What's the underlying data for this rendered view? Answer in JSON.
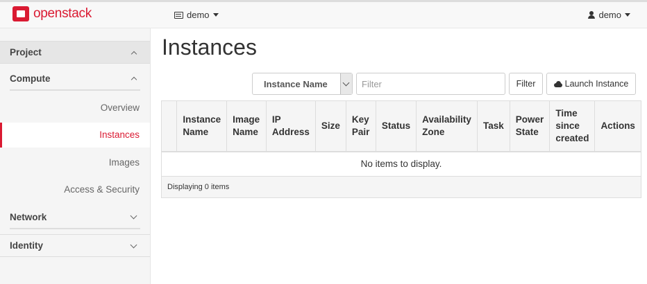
{
  "navbar": {
    "brand": "openstack",
    "project_label": "demo",
    "user_label": "demo"
  },
  "sidebar": {
    "project": "Project",
    "compute": "Compute",
    "items": [
      {
        "label": "Overview"
      },
      {
        "label": "Instances"
      },
      {
        "label": "Images"
      },
      {
        "label": "Access & Security"
      }
    ],
    "network": "Network",
    "identity": "Identity"
  },
  "main": {
    "title": "Instances",
    "filter_field": "Instance Name",
    "filter_placeholder": "Filter",
    "filter_button": "Filter",
    "launch_button": "Launch Instance",
    "columns": [
      [
        "Instance",
        "Name"
      ],
      [
        "Image",
        "Name"
      ],
      [
        "IP",
        "Address"
      ],
      [
        "Size"
      ],
      [
        "Key",
        "Pair"
      ],
      [
        "Status"
      ],
      [
        "Availability",
        "Zone"
      ],
      [
        "Task"
      ],
      [
        "Power",
        "State"
      ],
      [
        "Time",
        "since",
        "created"
      ],
      [
        "Actions"
      ]
    ],
    "empty_message": "No items to display.",
    "footer": "Displaying 0 items"
  },
  "colors": {
    "brand": "#da1a32",
    "active": "#da1a32"
  }
}
